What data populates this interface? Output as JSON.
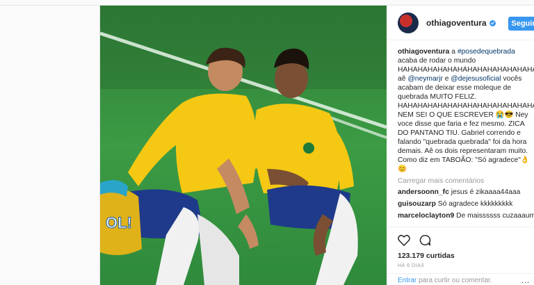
{
  "header": {
    "username": "othiagoventura",
    "follow_label": "Seguir"
  },
  "photo": {
    "badge_text": "OL!"
  },
  "caption": {
    "username": "othiagoventura",
    "part1": " a ",
    "hashtag": "#posedequebrada",
    "part2": " acaba de rodar o mundo HAHAHAHAHAHAHAHAHAHAHAHAHAHAHAHAHAH aê ",
    "mention1": "@neymarjr",
    "part3": " e ",
    "mention2": "@dejesusoficial",
    "part4": " vocês acabam de deixar esse moleque de quebrada MUITO FELIZ. HAHAHAHAHAHAHAHAHAHAHAHAHAHAHHHAHAAHHAHAHAHAAHAHAH NEM SEI O QUE ESCREVER 😭😎 Ney voce disse que faria e fez mesmo. ZICA DO PANTANO TIU. Gabriel correndo e falando \"quebrada quebrada\" foi da hora demais. Aê os dois representaram muito. Como diz em TABOÃO: \"Só agradece\"👌😊"
  },
  "load_more_label": "Carregar mais comentários",
  "comments": [
    {
      "user": "andersoonn_fc",
      "text": "jesus é zikaaaa44aaa"
    },
    {
      "user": "guisouzarp",
      "text": "Só agradece kkkkkkkkk"
    },
    {
      "user": "marceloclayton9",
      "text": "De maissssss cuzaaaum"
    }
  ],
  "actions": {
    "likes": "123.179 curtidas",
    "time": "HÁ 6 DIAS",
    "login_prompt_link": "Entrar",
    "login_prompt_rest": " para curtir ou comentar.",
    "more_label": "..."
  },
  "colors": {
    "accent": "#3897f0",
    "text": "#262626",
    "muted": "#999999",
    "link": "#003569",
    "jersey": "#f5c814",
    "shorts": "#1f3a8a",
    "pitch": "#2e8b3f"
  }
}
